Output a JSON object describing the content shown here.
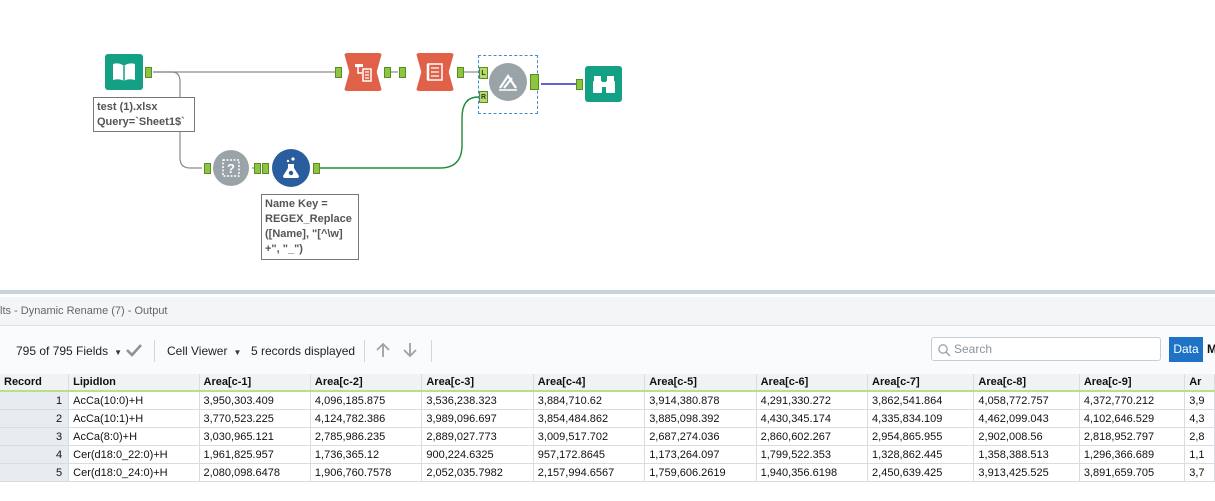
{
  "canvas": {
    "input_annotation": [
      "test (1).xlsx",
      "Query=`Sheet1$`"
    ],
    "formula_annotation": [
      "Name Key =",
      "REGEX_Replace",
      "([Name], \"[^\\w]",
      "+\", \"_\")"
    ],
    "join_anchors": {
      "left": "L",
      "right": "R"
    }
  },
  "results": {
    "title": "lts - Dynamic Rename (7) - Output"
  },
  "toolbar": {
    "fields": "795 of 795 Fields",
    "cell_viewer": "Cell Viewer",
    "records_displayed": "5 records displayed",
    "search_placeholder": "Search",
    "data_button": "Data",
    "metadata_button": "M"
  },
  "table": {
    "columns": [
      "Record",
      "LipidIon",
      "Area[c-1]",
      "Area[c-2]",
      "Area[c-3]",
      "Area[c-4]",
      "Area[c-5]",
      "Area[c-6]",
      "Area[c-7]",
      "Area[c-8]",
      "Area[c-9]",
      "Ar"
    ],
    "rows": [
      [
        "1",
        "AcCa(10:0)+H",
        "3,950,303.409",
        "4,096,185.875",
        "3,536,238.323",
        "3,884,710.62",
        "3,914,380.878",
        "4,291,330.272",
        "3,862,541.864",
        "4,058,772.757",
        "4,372,770.212",
        "3,9"
      ],
      [
        "2",
        "AcCa(10:1)+H",
        "3,770,523.225",
        "4,124,782.386",
        "3,989,096.697",
        "3,854,484.862",
        "3,885,098.392",
        "4,430,345.174",
        "4,335,834.109",
        "4,462,099.043",
        "4,102,646.529",
        "4,3"
      ],
      [
        "3",
        "AcCa(8:0)+H",
        "3,030,965.121",
        "2,785,986.235",
        "2,889,027.773",
        "3,009,517.702",
        "2,687,274.036",
        "2,860,602.267",
        "2,954,865.955",
        "2,902,008.56",
        "2,818,952.797",
        "2,8"
      ],
      [
        "4",
        "Cer(d18:0_22:0)+H",
        "1,961,825.957",
        "1,736,365.12",
        "900,224.6325",
        "957,172.8645",
        "1,173,264.097",
        "1,799,522.353",
        "1,328,862.445",
        "1,358,388.513",
        "1,296,366.689",
        "1,1"
      ],
      [
        "5",
        "Cer(d18:0_24:0)+H",
        "2,080,098.6478",
        "1,906,760.7578",
        "2,052,035.7982",
        "2,157,994.6567",
        "1,759,606.2619",
        "1,940,356.6198",
        "2,450,639.425",
        "3,913,425.525",
        "3,891,659.705",
        "3,7"
      ]
    ]
  },
  "colors": {
    "input_tool": "#13a085",
    "developer_tool": "#e06048",
    "join_tool": "#9aa3a8",
    "browse_tool": "#13a085",
    "formula_tool": "#2a5d9e",
    "anchor_green": "#8cc63f",
    "data_button": "#1f73c6"
  },
  "icons": [
    "book-icon",
    "dynamic-rename-icon",
    "dynamic-select-icon",
    "join-icon",
    "binoculars-icon",
    "test-tool-icon",
    "formula-flask-icon",
    "checkmark-icon",
    "arrow-up-icon",
    "arrow-down-icon",
    "search-icon"
  ]
}
